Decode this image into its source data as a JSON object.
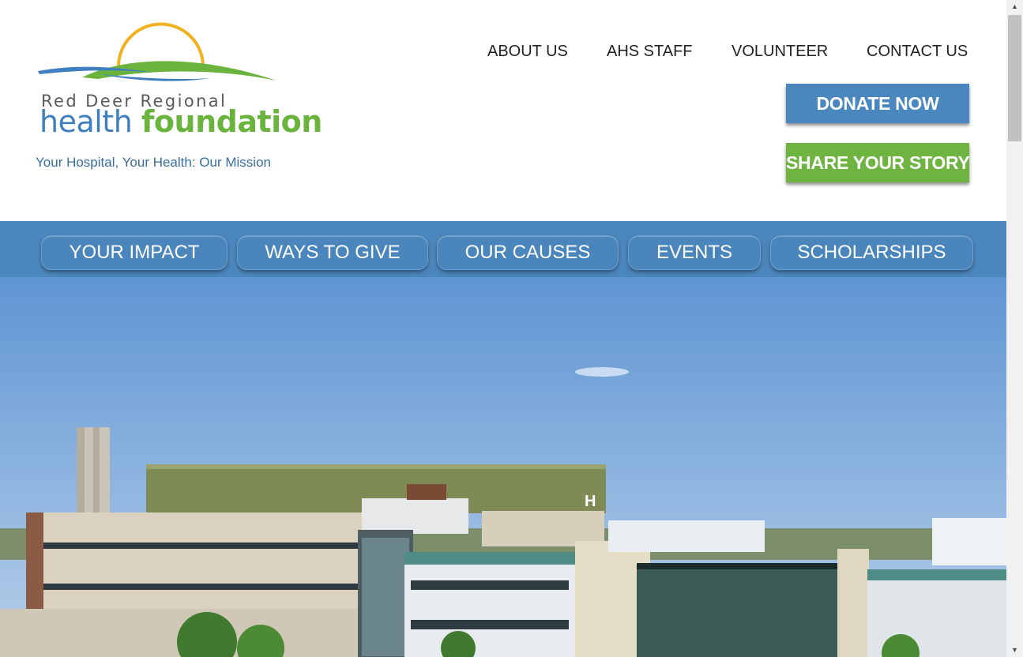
{
  "logo": {
    "line1": "Red Deer Regional",
    "health": "health",
    "foundation": "foundation",
    "tagline": "Your Hospital, Your Health: Our Mission"
  },
  "top_nav": [
    "ABOUT US",
    "AHS STAFF",
    "VOLUNTEER",
    "CONTACT US"
  ],
  "cta": {
    "donate": "DONATE NOW",
    "share": "SHARE YOUR STORY"
  },
  "main_nav": [
    "YOUR IMPACT",
    "WAYS TO GIVE",
    "OUR CAUSES",
    "EVENTS",
    "SCHOLARSHIPS"
  ],
  "hero": {
    "helipad_letter": "H"
  },
  "colors": {
    "nav_blue": "#4b87bd",
    "donate_blue": "#4a87bf",
    "share_green": "#6fb340",
    "logo_blue": "#3f7fbf",
    "logo_green": "#6ab43e",
    "sun_yellow": "#f0b21f"
  },
  "icons": {
    "scroll_up": "scroll-up-arrow-icon",
    "scroll_down": "scroll-down-arrow-icon"
  }
}
